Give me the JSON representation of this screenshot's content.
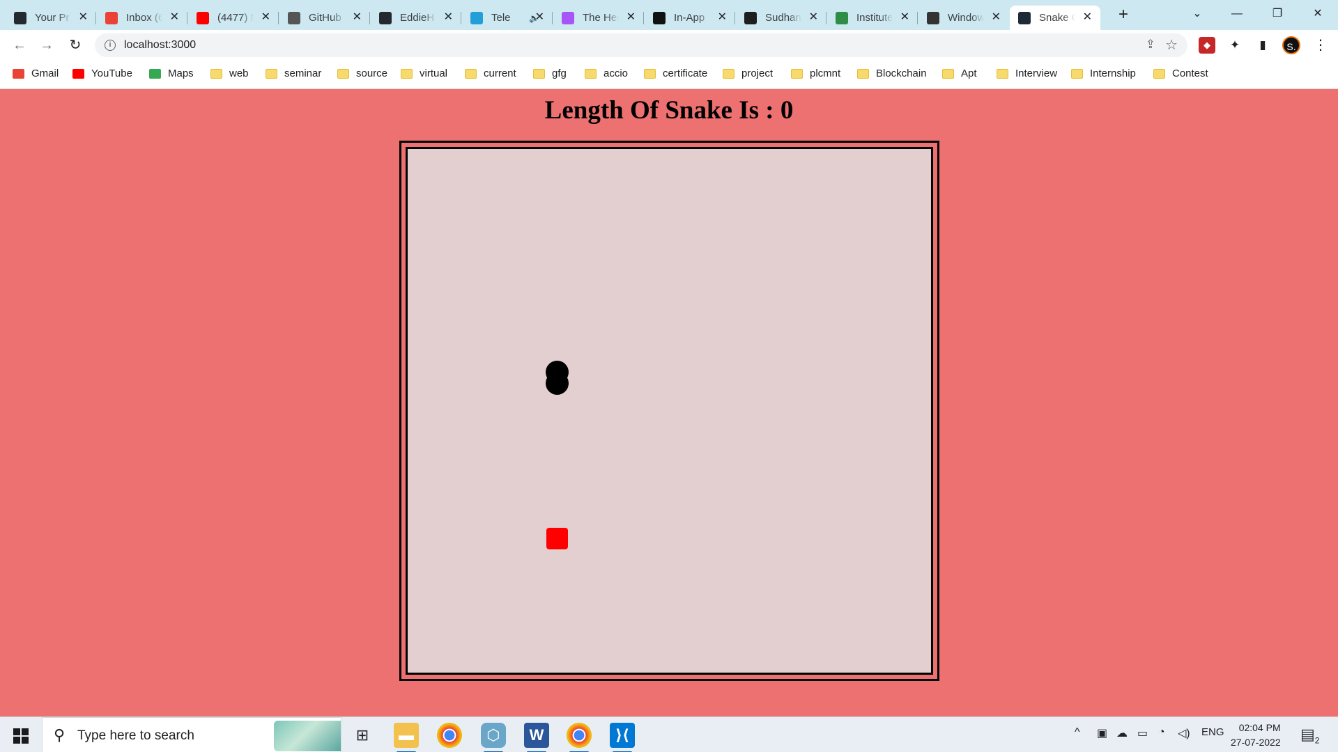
{
  "tabs": [
    {
      "label": "Your Pr",
      "icon": "github-icon",
      "color": "#24292f",
      "active": false
    },
    {
      "label": "Inbox (6",
      "icon": "gmail-icon",
      "color": "#ea4335",
      "active": false
    },
    {
      "label": "(4477) N",
      "icon": "youtube-icon",
      "color": "#ff0000",
      "active": false
    },
    {
      "label": "GitHub",
      "icon": "medium-icon",
      "color": "#555555",
      "active": false
    },
    {
      "label": "EddieH",
      "icon": "github-icon",
      "color": "#24292f",
      "active": false
    },
    {
      "label": "Tele",
      "icon": "telegram-icon",
      "color": "#229ed9",
      "active": false,
      "audio": true
    },
    {
      "label": "The Her",
      "icon": "hashnode-icon",
      "color": "#a855f7",
      "active": false
    },
    {
      "label": "In-App",
      "icon": "codepen-icon",
      "color": "#111111",
      "active": false
    },
    {
      "label": "Sudhan",
      "icon": "hackerearth-icon",
      "color": "#1e1e1e",
      "active": false
    },
    {
      "label": "Institute",
      "icon": "geeksforgeeks-icon",
      "color": "#2f8d46",
      "active": false
    },
    {
      "label": "Window",
      "icon": "wikipedia-icon",
      "color": "#333333",
      "active": false
    },
    {
      "label": "Snake G",
      "icon": "react-icon",
      "color": "#1e2a38",
      "active": true
    }
  ],
  "window": {
    "minimize": "—",
    "restore": "❐",
    "close": "✕",
    "tab_search": "⌄",
    "new_tab": "+"
  },
  "toolbar": {
    "back": "←",
    "forward": "→",
    "reload": "↻",
    "url": "localhost:3000",
    "profile_initial": "S."
  },
  "bookmarks": [
    {
      "label": "Gmail",
      "type": "site",
      "color": "#ea4335"
    },
    {
      "label": "YouTube",
      "type": "site",
      "color": "#ff0000"
    },
    {
      "label": "Maps",
      "type": "site",
      "color": "#34a853"
    },
    {
      "label": "web",
      "type": "folder"
    },
    {
      "label": "seminar",
      "type": "folder"
    },
    {
      "label": "source",
      "type": "folder"
    },
    {
      "label": "virtual",
      "type": "folder"
    },
    {
      "label": "current",
      "type": "folder"
    },
    {
      "label": "gfg",
      "type": "folder"
    },
    {
      "label": "accio",
      "type": "folder"
    },
    {
      "label": "certificate",
      "type": "folder"
    },
    {
      "label": "project",
      "type": "folder"
    },
    {
      "label": "plcmnt",
      "type": "folder"
    },
    {
      "label": "Blockchain",
      "type": "folder"
    },
    {
      "label": "Apt",
      "type": "folder"
    },
    {
      "label": "Interview",
      "type": "folder"
    },
    {
      "label": "Internship",
      "type": "folder"
    },
    {
      "label": "Contest",
      "type": "folder"
    }
  ],
  "game": {
    "title": "Length Of Snake Is : 0",
    "board_color": "#e3cfcf",
    "page_background": "#ec7170",
    "snake_color": "#000000",
    "food_color": "#ff0000"
  },
  "taskbar": {
    "search_placeholder": "Type here to search",
    "language": "ENG",
    "time": "02:04 PM",
    "date": "27-07-2022",
    "notification_count": "2"
  }
}
